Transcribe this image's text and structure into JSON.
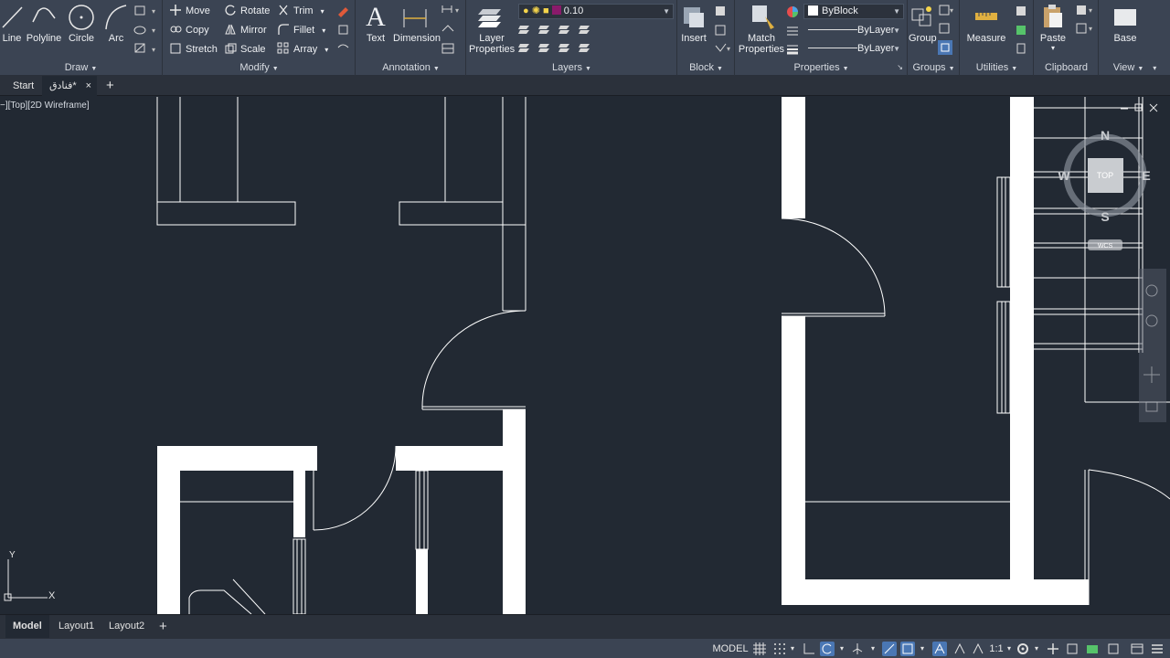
{
  "ribbon": {
    "draw": {
      "title": "Draw",
      "line": "Line",
      "polyline": "Polyline",
      "circle": "Circle",
      "arc": "Arc"
    },
    "modify": {
      "title": "Modify",
      "move": "Move",
      "rotate": "Rotate",
      "trim": "Trim",
      "copy": "Copy",
      "mirror": "Mirror",
      "fillet": "Fillet",
      "stretch": "Stretch",
      "scale": "Scale",
      "array": "Array"
    },
    "annotation": {
      "title": "Annotation",
      "text": "Text",
      "dimension": "Dimension"
    },
    "layers": {
      "title": "Layers",
      "layer_properties_1": "Layer",
      "layer_properties_2": "Properties",
      "current_layer": "0.10"
    },
    "block": {
      "title": "Block",
      "insert": "Insert"
    },
    "properties": {
      "title": "Properties",
      "match_1": "Match",
      "match_2": "Properties",
      "color": "ByBlock",
      "linetype": "ByLayer",
      "lineweight": "ByLayer"
    },
    "groups": {
      "title": "Groups",
      "group": "Group"
    },
    "utilities": {
      "title": "Utilities",
      "measure": "Measure"
    },
    "clipboard": {
      "title": "Clipboard",
      "paste": "Paste"
    },
    "view": {
      "title": "View",
      "base": "Base"
    }
  },
  "file_tabs": {
    "start": "Start",
    "drawing": "فنادق*",
    "close": "×",
    "add": "+"
  },
  "viewport": {
    "label": "−][Top][2D Wireframe]",
    "viewcube": {
      "north": "N",
      "south": "S",
      "east": "E",
      "west": "W",
      "top": "TOP",
      "wcs": "WCS"
    },
    "ucs": {
      "x": "X",
      "y": "Y"
    }
  },
  "layout_tabs": {
    "model": "Model",
    "layout1": "Layout1",
    "layout2": "Layout2",
    "add": "+"
  },
  "status": {
    "model": "MODEL",
    "scale": "1:1"
  },
  "colors": {
    "ribbon_bg": "#3b4453",
    "canvas_bg": "#222933",
    "accent": "#4a77b4",
    "wall": "#ffffff"
  }
}
